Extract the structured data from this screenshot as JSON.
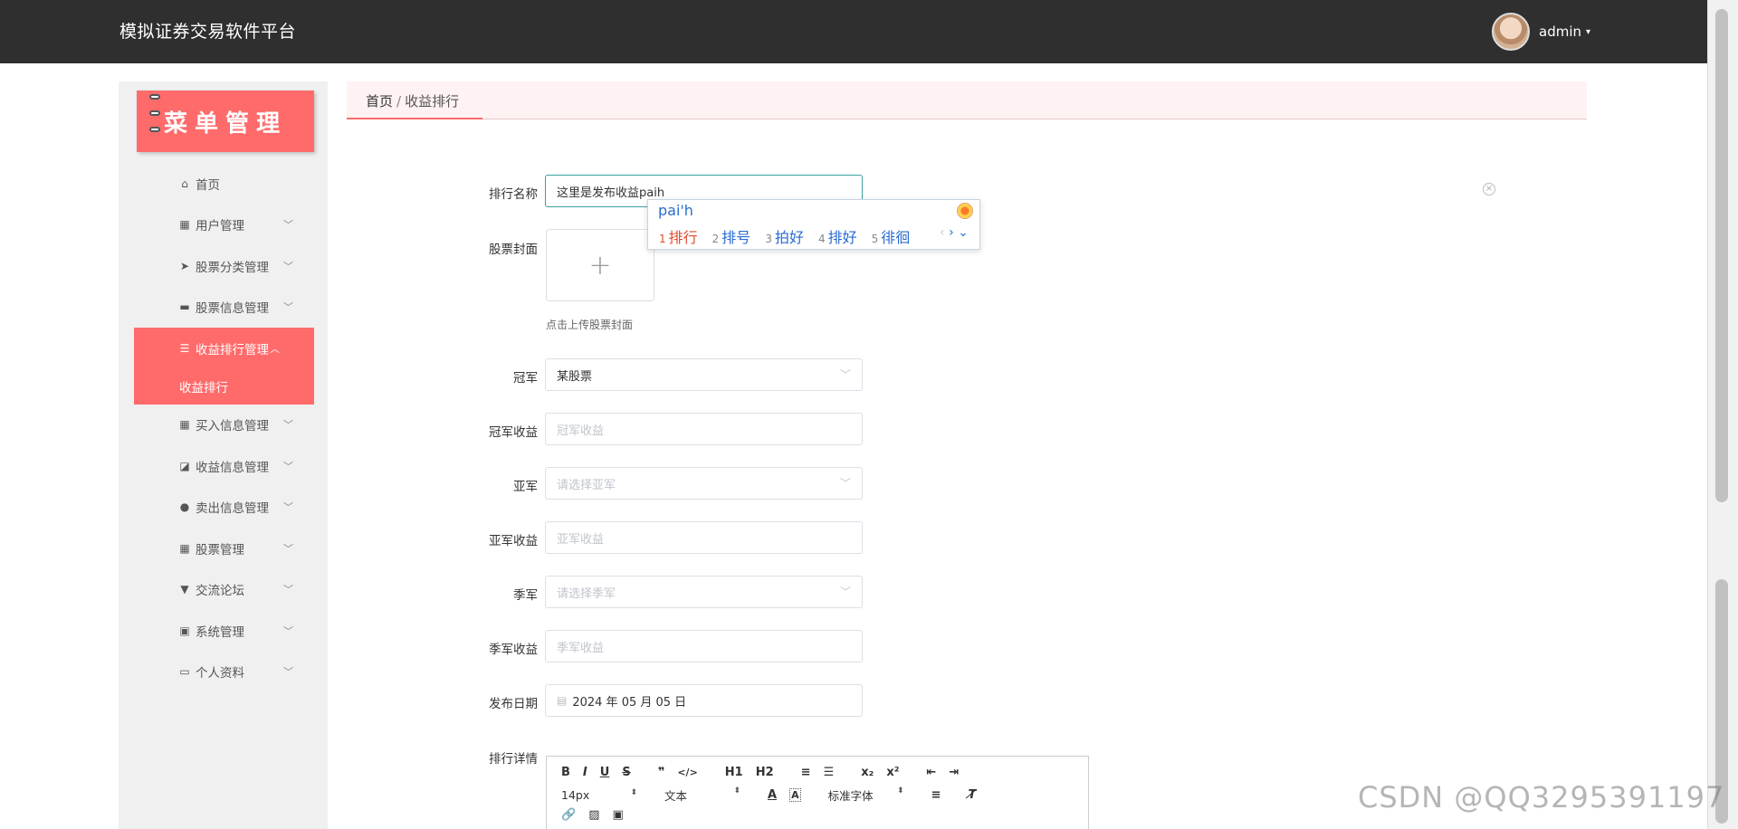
{
  "header": {
    "title": "模拟证券交易软件平台",
    "username": "admin"
  },
  "sidebar": {
    "banner": "菜单管理",
    "items": [
      {
        "label": "首页",
        "icon": "home-icon"
      },
      {
        "label": "用户管理",
        "icon": "grid-icon"
      },
      {
        "label": "股票分类管理",
        "icon": "send-icon"
      },
      {
        "label": "股票信息管理",
        "icon": "folder-icon"
      },
      {
        "label": "收益排行管理",
        "icon": "list-icon"
      },
      {
        "label": "买入信息管理",
        "icon": "grid-icon"
      },
      {
        "label": "收益信息管理",
        "icon": "chart-icon"
      },
      {
        "label": "卖出信息管理",
        "icon": "user-icon"
      },
      {
        "label": "股票管理",
        "icon": "grid-icon"
      },
      {
        "label": "交流论坛",
        "icon": "signpost-icon"
      },
      {
        "label": "系统管理",
        "icon": "clipboard-icon"
      },
      {
        "label": "个人资料",
        "icon": "card-icon"
      }
    ],
    "active_submenu": "收益排行"
  },
  "breadcrumb": {
    "home": "首页",
    "separator": "/",
    "current": "收益排行"
  },
  "form": {
    "rank_name": {
      "label": "排行名称",
      "value": "这里是发布收益paih"
    },
    "cover": {
      "label": "股票封面",
      "hint": "点击上传股票封面",
      "plus": "+"
    },
    "champion": {
      "label": "冠军",
      "value": "某股票"
    },
    "champion_profit": {
      "label": "冠军收益",
      "placeholder": "冠军收益"
    },
    "runner_up": {
      "label": "亚军",
      "placeholder": "请选择亚军"
    },
    "runner_up_profit": {
      "label": "亚军收益",
      "placeholder": "亚军收益"
    },
    "third": {
      "label": "季军",
      "placeholder": "请选择季军"
    },
    "third_profit": {
      "label": "季军收益",
      "placeholder": "季军收益"
    },
    "publish_date": {
      "label": "发布日期",
      "value": "2024 年 05 月 05 日"
    },
    "detail": {
      "label": "排行详情"
    }
  },
  "ime": {
    "input": "pai'h",
    "candidates": [
      {
        "n": "1",
        "text": "排行"
      },
      {
        "n": "2",
        "text": "排号"
      },
      {
        "n": "3",
        "text": "拍好"
      },
      {
        "n": "4",
        "text": "排好"
      },
      {
        "n": "5",
        "text": "徘徊"
      }
    ]
  },
  "editor": {
    "row1": [
      "B",
      "I",
      "U",
      "S",
      "❞",
      "</>",
      "H1",
      "H2",
      "≡",
      "☰",
      "x₂",
      "x²",
      "⇤",
      "⇥"
    ],
    "font_size": "14px",
    "text_type": "文本",
    "font_family": "标准字体"
  },
  "watermark": "CSDN @QQ3295391197"
}
